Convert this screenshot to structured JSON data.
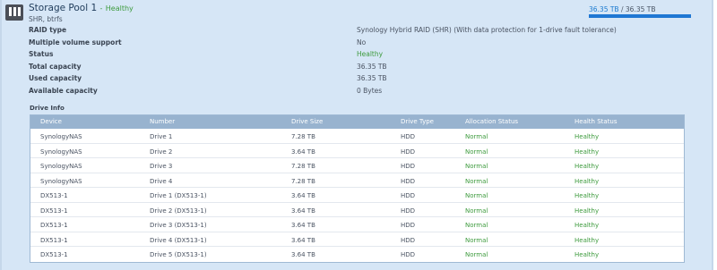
{
  "pool": {
    "title": "Storage Pool 1",
    "separator": "-",
    "status": "Healthy",
    "subtitle": "SHR, btrfs",
    "capacity_used": "36.35 TB",
    "capacity_sep": "/",
    "capacity_total": "36.35 TB",
    "capacity_fraction": 1.0
  },
  "properties": [
    {
      "label": "RAID type",
      "value": "Synology Hybrid RAID (SHR) (With data protection for 1-drive fault tolerance)"
    },
    {
      "label": "Multiple volume support",
      "value": "No"
    },
    {
      "label": "Status",
      "value": "Healthy"
    },
    {
      "label": "Total capacity",
      "value": "36.35 TB"
    },
    {
      "label": "Used capacity",
      "value": "36.35 TB"
    },
    {
      "label": "Available capacity",
      "value": "0 Bytes"
    }
  ],
  "drive_info": {
    "title": "Drive Info",
    "columns": [
      "Device",
      "Number",
      "Drive Size",
      "Drive Type",
      "Allocation Status",
      "Health Status"
    ],
    "rows": [
      [
        "SynologyNAS",
        "Drive 1",
        "7.28 TB",
        "HDD",
        "Normal",
        "Healthy"
      ],
      [
        "SynologyNAS",
        "Drive 2",
        "3.64 TB",
        "HDD",
        "Normal",
        "Healthy"
      ],
      [
        "SynologyNAS",
        "Drive 3",
        "7.28 TB",
        "HDD",
        "Normal",
        "Healthy"
      ],
      [
        "SynologyNAS",
        "Drive 4",
        "7.28 TB",
        "HDD",
        "Normal",
        "Healthy"
      ],
      [
        "DX513-1",
        "Drive 1 (DX513-1)",
        "3.64 TB",
        "HDD",
        "Normal",
        "Healthy"
      ],
      [
        "DX513-1",
        "Drive 2 (DX513-1)",
        "3.64 TB",
        "HDD",
        "Normal",
        "Healthy"
      ],
      [
        "DX513-1",
        "Drive 3 (DX513-1)",
        "3.64 TB",
        "HDD",
        "Normal",
        "Healthy"
      ],
      [
        "DX513-1",
        "Drive 4 (DX513-1)",
        "3.64 TB",
        "HDD",
        "Normal",
        "Healthy"
      ],
      [
        "DX513-1",
        "Drive 5 (DX513-1)",
        "3.64 TB",
        "HDD",
        "Normal",
        "Healthy"
      ]
    ]
  },
  "colors": {
    "panel_bg": "#d6e6f6",
    "healthy_green": "#3e9b3e",
    "capacity_blue": "#1f77d3",
    "table_header": "#98b3cf"
  },
  "icons": {
    "pool": "storage-pool-icon"
  }
}
